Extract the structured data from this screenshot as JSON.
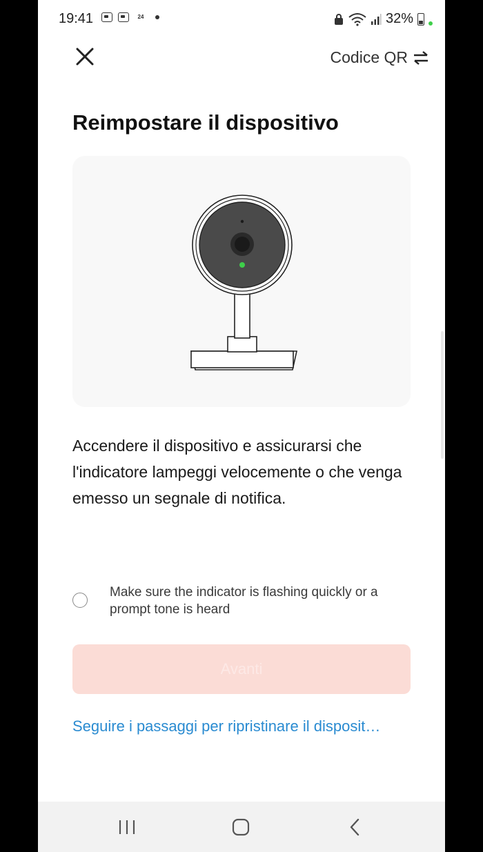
{
  "status_bar": {
    "time": "19:41",
    "badge": "24",
    "battery": "32%"
  },
  "header": {
    "qr_label": "Codice QR"
  },
  "page": {
    "title": "Reimpostare il dispositivo",
    "instructions": "Accendere il dispositivo e assicurarsi che l'indicatore lampeggi velocemente o che venga emesso un segnale di notifica.",
    "confirm_text": "Make sure the indicator is flashing quickly or a prompt tone is heard",
    "next_label": "Avanti",
    "reset_link": "Seguire i passaggi per ripristinare il disposit…"
  },
  "icons": {
    "close": "close-icon",
    "swap": "swap-icon",
    "camera": "camera-illustration"
  },
  "colors": {
    "next_button_bg": "#fbdcd6",
    "link": "#2a8bd1",
    "led": "#3ecf4a"
  }
}
